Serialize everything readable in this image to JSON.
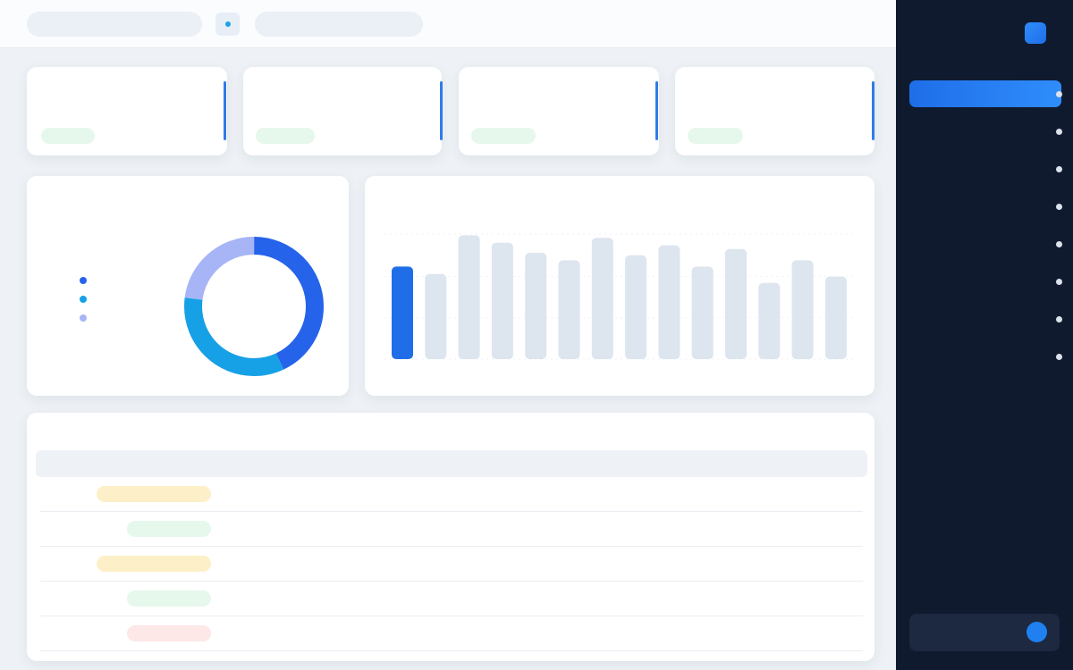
{
  "header": {
    "pill1_text": "",
    "top_title": ""
  },
  "sidebar": {
    "brand": "",
    "items": [
      {
        "label": ""
      },
      {
        "label": ""
      },
      {
        "label": ""
      },
      {
        "label": ""
      },
      {
        "label": ""
      },
      {
        "label": ""
      },
      {
        "label": ""
      },
      {
        "label": ""
      }
    ]
  },
  "stats": [
    {
      "label": "",
      "value": "",
      "badge": ""
    },
    {
      "label": "",
      "value": "",
      "badge": ""
    },
    {
      "label": "",
      "value": "",
      "badge": ""
    },
    {
      "label": "",
      "value": "",
      "badge": ""
    }
  ],
  "donut": {
    "title": "",
    "center": "",
    "legend": [
      {
        "name": "",
        "value": "",
        "color": "#2563eb"
      },
      {
        "name": "",
        "value": "",
        "color": "#16a0e6"
      },
      {
        "name": "",
        "value": "",
        "color": "#a7b4f5"
      }
    ]
  },
  "bar_panel": {
    "title": "",
    "unit": ""
  },
  "chart_data": {
    "type": "bar",
    "categories": [
      "",
      "",
      "",
      "",
      "",
      "",
      "",
      "",
      "",
      "",
      "",
      "",
      "",
      ""
    ],
    "values": [
      74,
      68,
      99,
      93,
      85,
      79,
      97,
      83,
      91,
      74,
      88,
      61,
      79,
      66
    ],
    "highlight_index": 0,
    "ylim": [
      0,
      100
    ],
    "title": ""
  },
  "table": {
    "title": "",
    "headers": [
      "",
      "",
      "",
      ""
    ],
    "rows": [
      {
        "status": "",
        "status_color": "yellow",
        "cells": [
          "",
          "",
          ""
        ]
      },
      {
        "status": "",
        "status_color": "green",
        "cells": [
          "",
          "",
          ""
        ]
      },
      {
        "status": "",
        "status_color": "yellow",
        "cells": [
          "",
          "",
          ""
        ]
      },
      {
        "status": "",
        "status_color": "green",
        "cells": [
          "",
          "",
          ""
        ]
      },
      {
        "status": "",
        "status_color": "red",
        "cells": [
          "",
          "",
          ""
        ]
      }
    ]
  },
  "colors": {
    "accent": "#1f6ee8",
    "sidebar_bg": "#0f1a2e",
    "bar_inactive": "#dde5ef",
    "donut_blue": "#2563eb",
    "donut_cyan": "#16a0e6",
    "donut_lilac": "#a7b4f5"
  }
}
